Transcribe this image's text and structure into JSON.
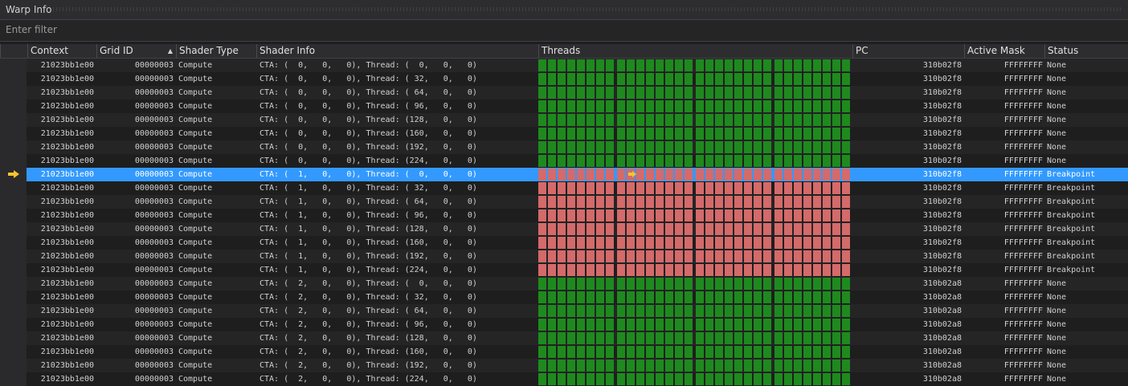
{
  "window": {
    "title": "Warp Info"
  },
  "filter": {
    "placeholder": "Enter filter",
    "value": ""
  },
  "columns": [
    {
      "key": "context",
      "label": "Context"
    },
    {
      "key": "grid",
      "label": "Grid ID"
    },
    {
      "key": "shader_type",
      "label": "Shader Type"
    },
    {
      "key": "shader_info",
      "label": "Shader Info"
    },
    {
      "key": "threads",
      "label": "Threads"
    },
    {
      "key": "pc",
      "label": "PC"
    },
    {
      "key": "active_mask",
      "label": "Active Mask"
    },
    {
      "key": "status",
      "label": "Status"
    }
  ],
  "sort_indicator": "▲",
  "colors": {
    "active_thread": "#1e8a1e",
    "breakpoint_thread": "#d46a6a",
    "selection": "#3399ff",
    "current_arrow": "#f4c430"
  },
  "rows": [
    {
      "context": "21023bb1e00",
      "grid": "00000003",
      "shader_type": "Compute",
      "shader_info": "CTA: (  0,   0,   0), Thread: (  0,   0,   0)",
      "pc": "310b02f8",
      "active_mask": "FFFFFFFF",
      "status": "None",
      "thread_state": "active"
    },
    {
      "context": "21023bb1e00",
      "grid": "00000003",
      "shader_type": "Compute",
      "shader_info": "CTA: (  0,   0,   0), Thread: ( 32,   0,   0)",
      "pc": "310b02f8",
      "active_mask": "FFFFFFFF",
      "status": "None",
      "thread_state": "active"
    },
    {
      "context": "21023bb1e00",
      "grid": "00000003",
      "shader_type": "Compute",
      "shader_info": "CTA: (  0,   0,   0), Thread: ( 64,   0,   0)",
      "pc": "310b02f8",
      "active_mask": "FFFFFFFF",
      "status": "None",
      "thread_state": "active"
    },
    {
      "context": "21023bb1e00",
      "grid": "00000003",
      "shader_type": "Compute",
      "shader_info": "CTA: (  0,   0,   0), Thread: ( 96,   0,   0)",
      "pc": "310b02f8",
      "active_mask": "FFFFFFFF",
      "status": "None",
      "thread_state": "active"
    },
    {
      "context": "21023bb1e00",
      "grid": "00000003",
      "shader_type": "Compute",
      "shader_info": "CTA: (  0,   0,   0), Thread: (128,   0,   0)",
      "pc": "310b02f8",
      "active_mask": "FFFFFFFF",
      "status": "None",
      "thread_state": "active"
    },
    {
      "context": "21023bb1e00",
      "grid": "00000003",
      "shader_type": "Compute",
      "shader_info": "CTA: (  0,   0,   0), Thread: (160,   0,   0)",
      "pc": "310b02f8",
      "active_mask": "FFFFFFFF",
      "status": "None",
      "thread_state": "active"
    },
    {
      "context": "21023bb1e00",
      "grid": "00000003",
      "shader_type": "Compute",
      "shader_info": "CTA: (  0,   0,   0), Thread: (192,   0,   0)",
      "pc": "310b02f8",
      "active_mask": "FFFFFFFF",
      "status": "None",
      "thread_state": "active"
    },
    {
      "context": "21023bb1e00",
      "grid": "00000003",
      "shader_type": "Compute",
      "shader_info": "CTA: (  0,   0,   0), Thread: (224,   0,   0)",
      "pc": "310b02f8",
      "active_mask": "FFFFFFFF",
      "status": "None",
      "thread_state": "active"
    },
    {
      "context": "21023bb1e00",
      "grid": "00000003",
      "shader_type": "Compute",
      "shader_info": "CTA: (  1,   0,   0), Thread: (  0,   0,   0)",
      "pc": "310b02f8",
      "active_mask": "FFFFFFFF",
      "status": "Breakpoint",
      "thread_state": "breakpoint",
      "selected": true,
      "current": true
    },
    {
      "context": "21023bb1e00",
      "grid": "00000003",
      "shader_type": "Compute",
      "shader_info": "CTA: (  1,   0,   0), Thread: ( 32,   0,   0)",
      "pc": "310b02f8",
      "active_mask": "FFFFFFFF",
      "status": "Breakpoint",
      "thread_state": "breakpoint"
    },
    {
      "context": "21023bb1e00",
      "grid": "00000003",
      "shader_type": "Compute",
      "shader_info": "CTA: (  1,   0,   0), Thread: ( 64,   0,   0)",
      "pc": "310b02f8",
      "active_mask": "FFFFFFFF",
      "status": "Breakpoint",
      "thread_state": "breakpoint"
    },
    {
      "context": "21023bb1e00",
      "grid": "00000003",
      "shader_type": "Compute",
      "shader_info": "CTA: (  1,   0,   0), Thread: ( 96,   0,   0)",
      "pc": "310b02f8",
      "active_mask": "FFFFFFFF",
      "status": "Breakpoint",
      "thread_state": "breakpoint"
    },
    {
      "context": "21023bb1e00",
      "grid": "00000003",
      "shader_type": "Compute",
      "shader_info": "CTA: (  1,   0,   0), Thread: (128,   0,   0)",
      "pc": "310b02f8",
      "active_mask": "FFFFFFFF",
      "status": "Breakpoint",
      "thread_state": "breakpoint"
    },
    {
      "context": "21023bb1e00",
      "grid": "00000003",
      "shader_type": "Compute",
      "shader_info": "CTA: (  1,   0,   0), Thread: (160,   0,   0)",
      "pc": "310b02f8",
      "active_mask": "FFFFFFFF",
      "status": "Breakpoint",
      "thread_state": "breakpoint"
    },
    {
      "context": "21023bb1e00",
      "grid": "00000003",
      "shader_type": "Compute",
      "shader_info": "CTA: (  1,   0,   0), Thread: (192,   0,   0)",
      "pc": "310b02f8",
      "active_mask": "FFFFFFFF",
      "status": "Breakpoint",
      "thread_state": "breakpoint"
    },
    {
      "context": "21023bb1e00",
      "grid": "00000003",
      "shader_type": "Compute",
      "shader_info": "CTA: (  1,   0,   0), Thread: (224,   0,   0)",
      "pc": "310b02f8",
      "active_mask": "FFFFFFFF",
      "status": "Breakpoint",
      "thread_state": "breakpoint"
    },
    {
      "context": "21023bb1e00",
      "grid": "00000003",
      "shader_type": "Compute",
      "shader_info": "CTA: (  2,   0,   0), Thread: (  0,   0,   0)",
      "pc": "310b02a8",
      "active_mask": "FFFFFFFF",
      "status": "None",
      "thread_state": "active"
    },
    {
      "context": "21023bb1e00",
      "grid": "00000003",
      "shader_type": "Compute",
      "shader_info": "CTA: (  2,   0,   0), Thread: ( 32,   0,   0)",
      "pc": "310b02a8",
      "active_mask": "FFFFFFFF",
      "status": "None",
      "thread_state": "active"
    },
    {
      "context": "21023bb1e00",
      "grid": "00000003",
      "shader_type": "Compute",
      "shader_info": "CTA: (  2,   0,   0), Thread: ( 64,   0,   0)",
      "pc": "310b02a8",
      "active_mask": "FFFFFFFF",
      "status": "None",
      "thread_state": "active"
    },
    {
      "context": "21023bb1e00",
      "grid": "00000003",
      "shader_type": "Compute",
      "shader_info": "CTA: (  2,   0,   0), Thread: ( 96,   0,   0)",
      "pc": "310b02a8",
      "active_mask": "FFFFFFFF",
      "status": "None",
      "thread_state": "active"
    },
    {
      "context": "21023bb1e00",
      "grid": "00000003",
      "shader_type": "Compute",
      "shader_info": "CTA: (  2,   0,   0), Thread: (128,   0,   0)",
      "pc": "310b02a8",
      "active_mask": "FFFFFFFF",
      "status": "None",
      "thread_state": "active"
    },
    {
      "context": "21023bb1e00",
      "grid": "00000003",
      "shader_type": "Compute",
      "shader_info": "CTA: (  2,   0,   0), Thread: (160,   0,   0)",
      "pc": "310b02a8",
      "active_mask": "FFFFFFFF",
      "status": "None",
      "thread_state": "active"
    },
    {
      "context": "21023bb1e00",
      "grid": "00000003",
      "shader_type": "Compute",
      "shader_info": "CTA: (  2,   0,   0), Thread: (192,   0,   0)",
      "pc": "310b02a8",
      "active_mask": "FFFFFFFF",
      "status": "None",
      "thread_state": "active"
    },
    {
      "context": "21023bb1e00",
      "grid": "00000003",
      "shader_type": "Compute",
      "shader_info": "CTA: (  2,   0,   0), Thread: (224,   0,   0)",
      "pc": "310b02a8",
      "active_mask": "FFFFFFFF",
      "status": "None",
      "thread_state": "active"
    }
  ]
}
